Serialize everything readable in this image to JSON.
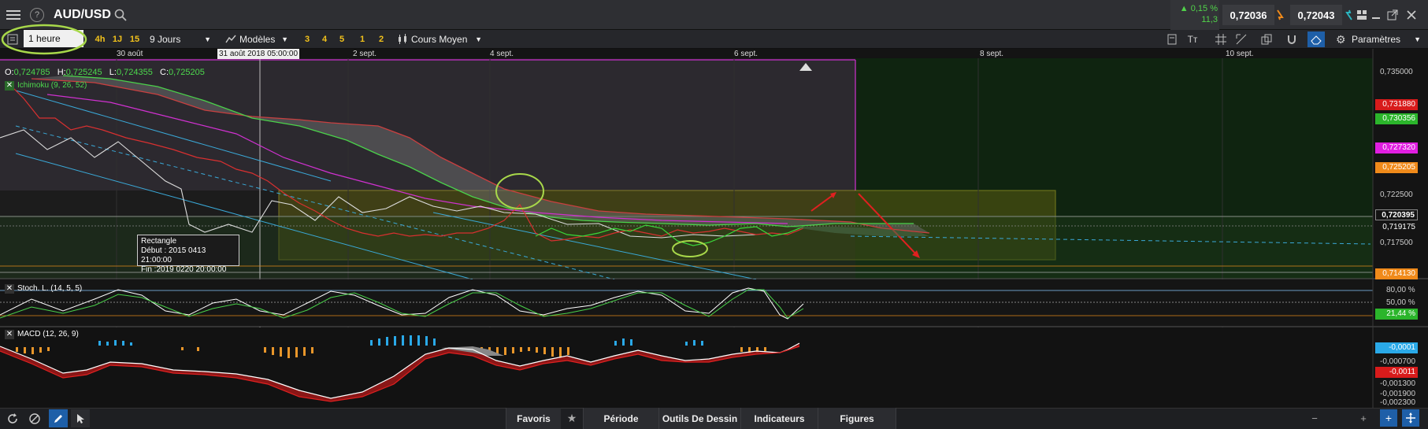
{
  "header": {
    "symbol": "AUD/USD",
    "change_pct": "▲ 0,15 %",
    "spread": "11,3",
    "sell_price": "0,72036",
    "buy_price": "0,72043"
  },
  "toolbar": {
    "period": "1 heure",
    "quick_periods": [
      "4h",
      "1J",
      "15"
    ],
    "range": "9 Jours",
    "templates": "Modèles",
    "quick_templates": [
      "3",
      "4",
      "5",
      "1",
      "2"
    ],
    "price_type": "Cours Moyen",
    "settings": "Paramètres",
    "crosshair_time": "31 août 2018 05:00:00"
  },
  "ohlc": {
    "o_label": "O:",
    "o": "0,724785",
    "h_label": "H:",
    "h": "0,725245",
    "l_label": "L:",
    "l": "0,724355",
    "c_label": "C:",
    "c": "0,725205"
  },
  "dates": [
    "30 août",
    "2 sept.",
    "4 sept.",
    "6 sept.",
    "8 sept.",
    "10 sept."
  ],
  "price_axis": {
    "labels": [
      "0,735000",
      "0,722500",
      "0,717500"
    ],
    "badges": [
      {
        "text": "0,731880",
        "color": "#d81b1b"
      },
      {
        "text": "0,730356",
        "color": "#2bb52b"
      },
      {
        "text": "0,727320",
        "color": "#e01ee0"
      },
      {
        "text": "0,725205",
        "color": "#f08a1a"
      },
      {
        "text": "0,720395",
        "color": "#141414"
      },
      {
        "text": "0,719175",
        "color": "#141414"
      },
      {
        "text": "0,714130",
        "color": "#f08a1a"
      }
    ]
  },
  "indicators": {
    "ichimoku": "Ichimoku (9, 26, 52)",
    "stoch": "Stoch. L. (14, 5, 5)",
    "stoch_axis": [
      "80,00 %",
      "50,00 %"
    ],
    "stoch_badge": "21,44 %",
    "macd": "MACD (12, 26, 9)",
    "macd_badges": [
      "-0,0001",
      "-0,0011"
    ],
    "macd_axis": [
      "-0,000700",
      "-0,001300",
      "-0,001900",
      "-0,002300"
    ]
  },
  "tooltip": {
    "title": "Rectangle",
    "line1": "Début : 2015 0413 21:00:00",
    "line2": "Fin :2019 0220 20:00:00"
  },
  "bottom": {
    "favoris": "Favoris",
    "periode": "Période",
    "outils": "Outils De Dessin",
    "indicateurs": "Indicateurs",
    "figures": "Figures"
  }
}
